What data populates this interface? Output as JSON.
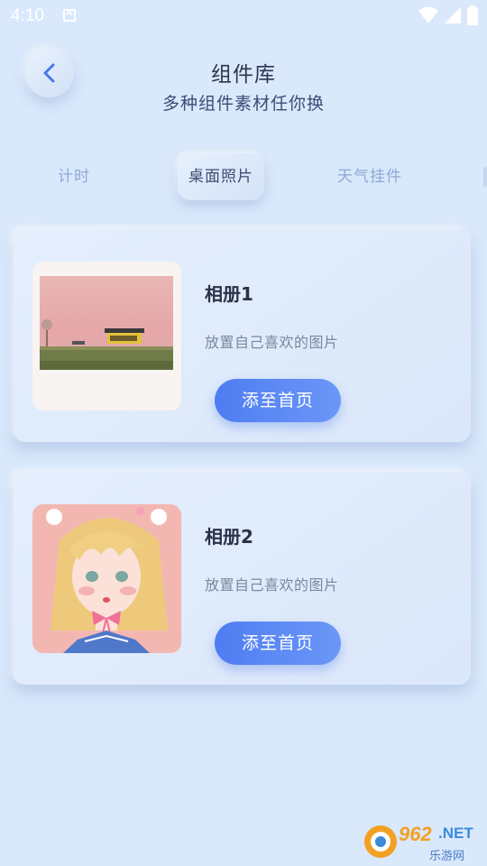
{
  "status_bar": {
    "time": "4:10"
  },
  "header": {
    "title": "组件库",
    "subtitle": "多种组件素材任你换"
  },
  "tabs": [
    {
      "label": "计时",
      "active": false
    },
    {
      "label": "桌面照片",
      "active": true
    },
    {
      "label": "天气挂件",
      "active": false
    }
  ],
  "cards": [
    {
      "title": "相册1",
      "description": "放置自己喜欢的图片",
      "button_label": "添至首页",
      "image": "sunset-landscape-photo"
    },
    {
      "title": "相册2",
      "description": "放置自己喜欢的图片",
      "button_label": "添至首页",
      "image": "anime-girl-illustration"
    }
  ],
  "watermark": {
    "number": "962",
    "suffix": ".NET",
    "text": "乐游网"
  },
  "colors": {
    "background": "#d9e8fb",
    "accent": "#4f7df2",
    "tab_inactive": "#8fa9d6",
    "title": "#2b3550"
  }
}
